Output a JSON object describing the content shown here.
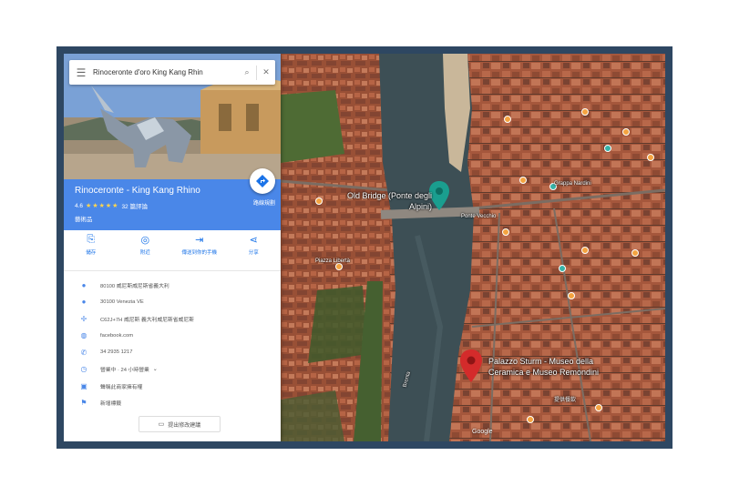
{
  "search": {
    "value": "Rinoceronte d'oro King Kang Rhin"
  },
  "place": {
    "name": "Rinoceronte - King Kang Rhino",
    "rating": "4.6",
    "stars": "★★★★★",
    "reviews": "32 篇評論",
    "category": "藝術品",
    "directions_label": "路線規劃"
  },
  "actions": [
    {
      "label": "儲存",
      "icon": "bookmark-icon"
    },
    {
      "label": "附近",
      "icon": "nearby-icon"
    },
    {
      "label": "傳送到你的手機",
      "icon": "send-to-phone-icon"
    },
    {
      "label": "分享",
      "icon": "share-icon"
    }
  ],
  "info": [
    {
      "text": "80100 威尼斯威尼斯省義大利",
      "icon": "location-pin-icon"
    },
    {
      "text": "30100 Venezia VE",
      "icon": "location-pin-icon"
    },
    {
      "text": "C62J+7H 威尼斯 義大利威尼斯省威尼斯",
      "icon": "plus-code-icon"
    },
    {
      "text": "facebook.com",
      "icon": "globe-icon"
    },
    {
      "text": "34 2935 1217",
      "icon": "phone-icon"
    },
    {
      "text": "營業中 · 24 小時營業",
      "icon": "clock-icon"
    },
    {
      "text": "聲稱此商家擁有權",
      "icon": "verified-icon"
    },
    {
      "text": "新增標籤",
      "icon": "flag-icon"
    }
  ],
  "suggest_edit": "提出修改建議",
  "map": {
    "bridge_label": "Old Bridge (Ponte degli Alpini)",
    "museum_label": "Palazzo Sturm - Museo della Ceramica e Museo Remondini",
    "river_label": "Brenta",
    "pins": [
      {
        "name": "Old Bridge",
        "color": "#1a9e8f"
      },
      {
        "name": "Palazzo Sturm",
        "color": "#d42b2b"
      }
    ],
    "small_labels": [
      "Ponte Vecchio",
      "Piazza Libertà",
      "Grappa Nardini",
      "提供餐飲"
    ],
    "attribution": "Google"
  }
}
